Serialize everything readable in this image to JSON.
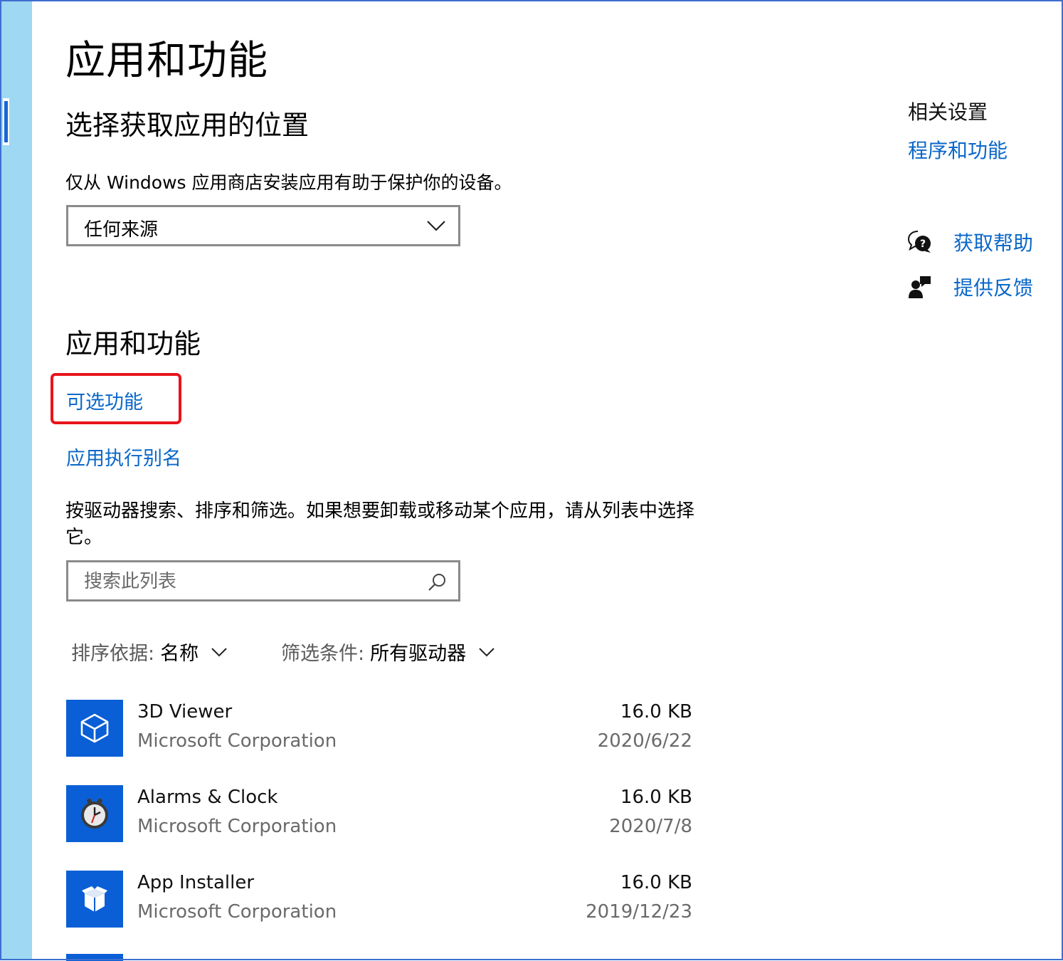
{
  "page": {
    "title": "应用和功能"
  },
  "install_source": {
    "heading": "选择获取应用的位置",
    "hint": "仅从 Windows 应用商店安装应用有助于保护你的设备。",
    "dropdown_value": "任何来源"
  },
  "apps_section": {
    "heading": "应用和功能",
    "optional_features_link": "可选功能",
    "aliases_link": "应用执行别名",
    "description": "按驱动器搜索、排序和筛选。如果想要卸载或移动某个应用，请从列表中选择它。",
    "search_placeholder": "搜索此列表",
    "sort_label": "排序依据:",
    "sort_value": "名称",
    "filter_label": "筛选条件:",
    "filter_value": "所有驱动器"
  },
  "apps": [
    {
      "name": "3D Viewer",
      "publisher": "Microsoft Corporation",
      "size": "16.0 KB",
      "date": "2020/6/22",
      "icon": "cube-icon"
    },
    {
      "name": "Alarms & Clock",
      "publisher": "Microsoft Corporation",
      "size": "16.0 KB",
      "date": "2020/7/8",
      "icon": "clock-icon"
    },
    {
      "name": "App Installer",
      "publisher": "Microsoft Corporation",
      "size": "16.0 KB",
      "date": "2019/12/23",
      "icon": "package-icon"
    }
  ],
  "related": {
    "heading": "相关设置",
    "programs_link": "程序和功能",
    "get_help": "获取帮助",
    "feedback": "提供反馈"
  },
  "colors": {
    "accent": "#0a67c9",
    "app_tile": "#0a5fd6",
    "highlight": "#e8141b",
    "left_strip": "#9fd8f2"
  }
}
